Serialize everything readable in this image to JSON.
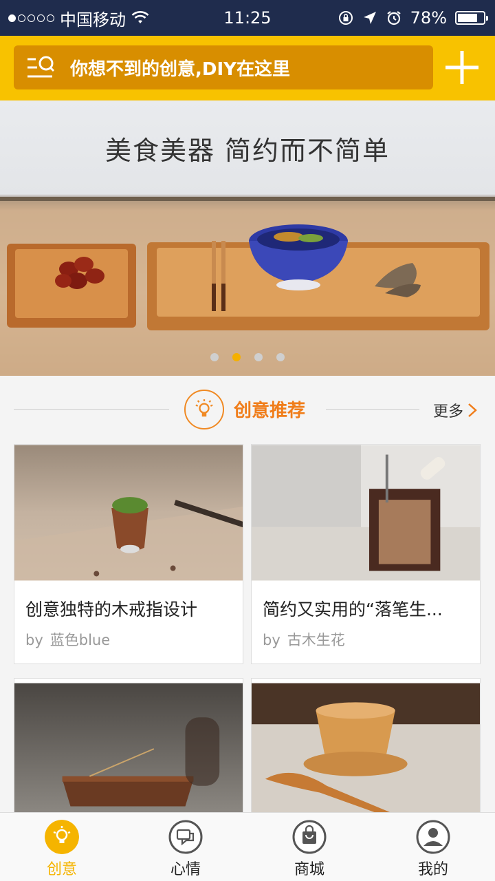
{
  "status_bar": {
    "carrier": "中国移动",
    "time": "11:25",
    "battery": "78%",
    "battery_level": 0.78
  },
  "header": {
    "search_placeholder": "你想不到的创意,DIY在这里"
  },
  "banner": {
    "title": "美食美器 简约而不简单",
    "page_count": 4,
    "active_index": 1
  },
  "section": {
    "title": "创意推荐",
    "more": "更多"
  },
  "cards": [
    {
      "title": "创意独特的木戒指设计",
      "by": "by",
      "author": "蓝色blue"
    },
    {
      "title": "简约又实用的“落笔生...",
      "by": "by",
      "author": "古木生花"
    },
    {
      "title": "",
      "by": "",
      "author": ""
    },
    {
      "title": "",
      "by": "",
      "author": ""
    }
  ],
  "tabs": [
    {
      "label": "创意",
      "icon": "lightbulb-icon",
      "active": true
    },
    {
      "label": "心情",
      "icon": "chat-icon",
      "active": false
    },
    {
      "label": "商城",
      "icon": "shopping-bag-icon",
      "active": false
    },
    {
      "label": "我的",
      "icon": "user-icon",
      "active": false
    }
  ],
  "colors": {
    "accent": "#f8c200",
    "search_bg": "#d88e00",
    "section_orange": "#f07d1a",
    "status_bar": "#1f2c4d"
  }
}
